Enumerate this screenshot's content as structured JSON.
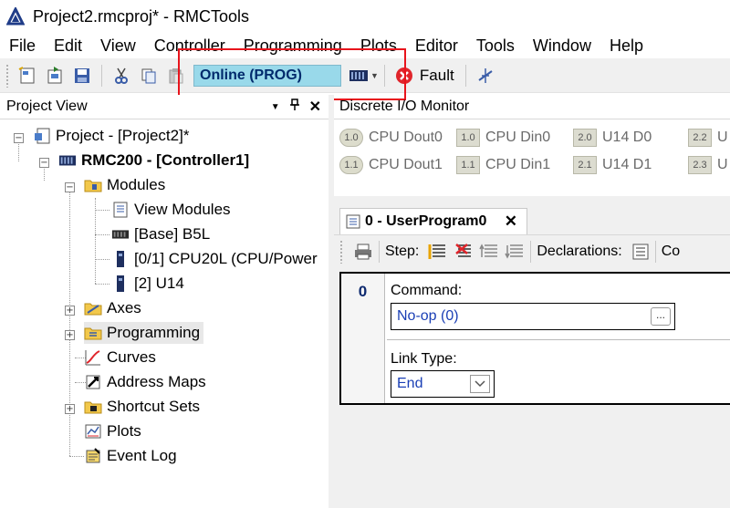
{
  "window": {
    "title": "Project2.rmcproj* - RMCTools"
  },
  "menu": [
    "File",
    "Edit",
    "View",
    "Controller",
    "Programming",
    "Plots",
    "Editor",
    "Tools",
    "Window",
    "Help"
  ],
  "toolbar": {
    "status": "Online (PROG)",
    "fault_label": "Fault"
  },
  "project_view": {
    "title": "Project View",
    "tree": {
      "project": "Project - [Project2]*",
      "controller": "RMC200 - [Controller1]",
      "modules": "Modules",
      "view_modules": "View Modules",
      "base": "[Base] B5L",
      "cpu": "[0/1] CPU20L (CPU/Power",
      "u14": "[2] U14",
      "axes": "Axes",
      "programming": "Programming",
      "curves": "Curves",
      "address_maps": "Address Maps",
      "shortcut_sets": "Shortcut Sets",
      "plots": "Plots",
      "event_log": "Event Log"
    }
  },
  "io_monitor": {
    "title": "Discrete I/O Monitor",
    "items": [
      {
        "badge": "1.0",
        "label": "CPU Dout0"
      },
      {
        "badge": "1.0",
        "label": "CPU Din0"
      },
      {
        "badge": "2.0",
        "label": "U14 D0"
      },
      {
        "badge": "2.2",
        "label": "U"
      },
      {
        "badge": "1.1",
        "label": "CPU Dout1"
      },
      {
        "badge": "1.1",
        "label": "CPU Din1"
      },
      {
        "badge": "2.1",
        "label": "U14 D1"
      },
      {
        "badge": "2.3",
        "label": "U"
      }
    ]
  },
  "editor": {
    "tab_label": "0 - UserProgram0",
    "step_label": "Step:",
    "declarations_label": "Declarations:",
    "truncated_label": "Co",
    "step_number": "0",
    "command_label": "Command:",
    "command_value": "No-op (0)",
    "command_button": "...",
    "link_type_label": "Link Type:",
    "link_type_value": "End"
  }
}
